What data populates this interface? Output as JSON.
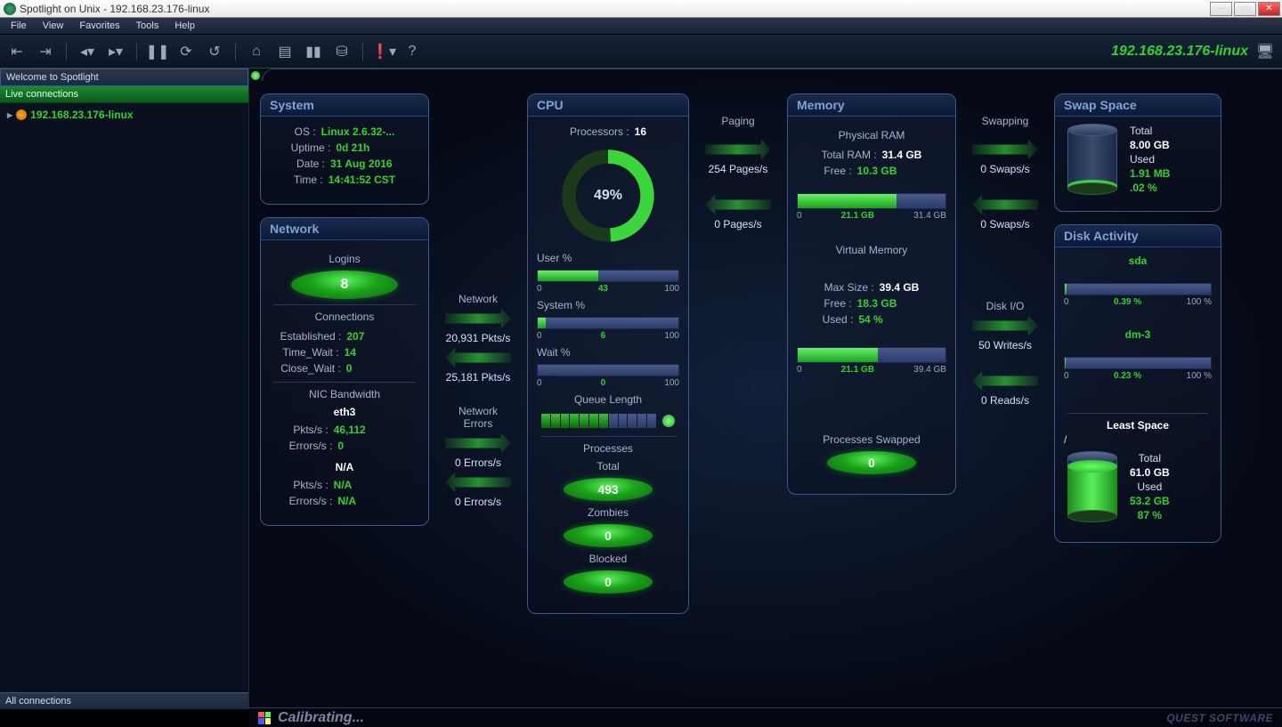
{
  "window": {
    "title": "Spotlight on Unix - 192.168.23.176-linux"
  },
  "menus": [
    "File",
    "View",
    "Favorites",
    "Tools",
    "Help"
  ],
  "host_label": "192.168.23.176-linux",
  "sidebar": {
    "header": "Welcome to Spotlight",
    "subheader": "Live connections",
    "tree_item": "192.168.23.176-linux",
    "footer": "All connections"
  },
  "status": {
    "calibrating": "Calibrating...",
    "vendor": "QUEST SOFTWARE"
  },
  "panels": {
    "system": {
      "title": "System",
      "os_label": "OS :",
      "os": "Linux 2.6.32-...",
      "uptime_label": "Uptime :",
      "uptime": "0d 21h",
      "date_label": "Date :",
      "date": "31 Aug 2016",
      "time_label": "Time :",
      "time": "14:41:52 CST"
    },
    "network": {
      "title": "Network",
      "logins_label": "Logins",
      "logins": "8",
      "connections_label": "Connections",
      "established_label": "Established :",
      "established": "207",
      "timewait_label": "Time_Wait :",
      "timewait": "14",
      "closewait_label": "Close_Wait :",
      "closewait": "0",
      "nic_label": "NIC Bandwidth",
      "nic1_name": "eth3",
      "nic1_pkts_label": "Pkts/s :",
      "nic1_pkts": "46,112",
      "nic1_err_label": "Errors/s :",
      "nic1_err": "0",
      "nic2_name": "N/A",
      "nic2_pkts": "N/A",
      "nic2_err": "N/A"
    },
    "cpu": {
      "title": "CPU",
      "processors_label": "Processors :",
      "processors": "16",
      "gauge": "49%",
      "user_label": "User %",
      "user_val": "43",
      "system_label": "System %",
      "system_val": "6",
      "wait_label": "Wait %",
      "wait_val": "0",
      "scale0": "0",
      "scale100": "100",
      "queue_label": "Queue Length",
      "processes_label": "Processes",
      "total_label": "Total",
      "total": "493",
      "zombies_label": "Zombies",
      "zombies": "0",
      "blocked_label": "Blocked",
      "blocked": "0"
    },
    "memory": {
      "title": "Memory",
      "phys_label": "Physical RAM",
      "total_ram_label": "Total RAM :",
      "total_ram": "31.4 GB",
      "free_label": "Free :",
      "free": "10.3 GB",
      "bar_mid": "21.1 GB",
      "bar_min": "0",
      "bar_max": "31.4 GB",
      "vm_label": "Virtual Memory",
      "vm_max_label": "Max Size :",
      "vm_max": "39.4 GB",
      "vm_free_label": "Free :",
      "vm_free": "18.3 GB",
      "vm_used_label": "Used :",
      "vm_used": "54 %",
      "vm_bar_mid": "21.1 GB",
      "vm_bar_max": "39.4 GB",
      "swapped_label": "Processes Swapped",
      "swapped": "0"
    },
    "swap": {
      "title": "Swap Space",
      "total_label": "Total",
      "total": "8.00 GB",
      "used_label": "Used",
      "used": "1.91 MB",
      "used_pct": ".02 %"
    },
    "disk": {
      "title": "Disk Activity",
      "d1_name": "sda",
      "d1_pct": "0.39 %",
      "d2_name": "dm-3",
      "d2_pct": "0.23 %",
      "scale0": "0",
      "scale100": "100 %",
      "least_label": "Least Space",
      "path": "/",
      "total_label": "Total",
      "total": "61.0 GB",
      "used_label": "Used",
      "used": "53.2 GB",
      "used_pct": "87 %"
    }
  },
  "flows": {
    "network_label": "Network",
    "net_out": "20,931 Pkts/s",
    "net_in": "25,181 Pkts/s",
    "neterr_label": "Network Errors",
    "neterr_out": "0 Errors/s",
    "neterr_in": "0 Errors/s",
    "paging_label": "Paging",
    "paging_out": "254 Pages/s",
    "paging_in": "0 Pages/s",
    "swapping_label": "Swapping",
    "swap_out": "0 Swaps/s",
    "swap_in": "0 Swaps/s",
    "diskio_label": "Disk I/O",
    "disk_writes": "50 Writes/s",
    "disk_reads": "0 Reads/s"
  }
}
